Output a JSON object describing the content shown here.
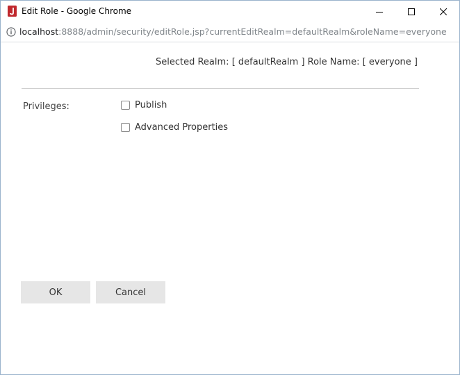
{
  "window": {
    "title": "Edit Role - Google Chrome",
    "icon": "jreport-app-icon",
    "controls": {
      "minimize": "minimize-icon",
      "maximize": "maximize-icon",
      "close": "close-icon"
    }
  },
  "address_bar": {
    "host": "localhost",
    "path": ":8888/admin/security/editRole.jsp?currentEditRealm=defaultRealm&roleName=everyone"
  },
  "header": {
    "realm_info": "Selected Realm: [ defaultRealm ]  Role Name: [ everyone ]"
  },
  "privileges": {
    "label": "Privileges:",
    "options": [
      {
        "label": "Publish",
        "checked": false
      },
      {
        "label": "Advanced Properties",
        "checked": false
      }
    ]
  },
  "buttons": {
    "ok": "OK",
    "cancel": "Cancel"
  },
  "colors": {
    "app_icon": "#c0282d",
    "button_bg": "#e6e6e6",
    "divider": "#cfcfcf",
    "url_path": "#80868b"
  }
}
